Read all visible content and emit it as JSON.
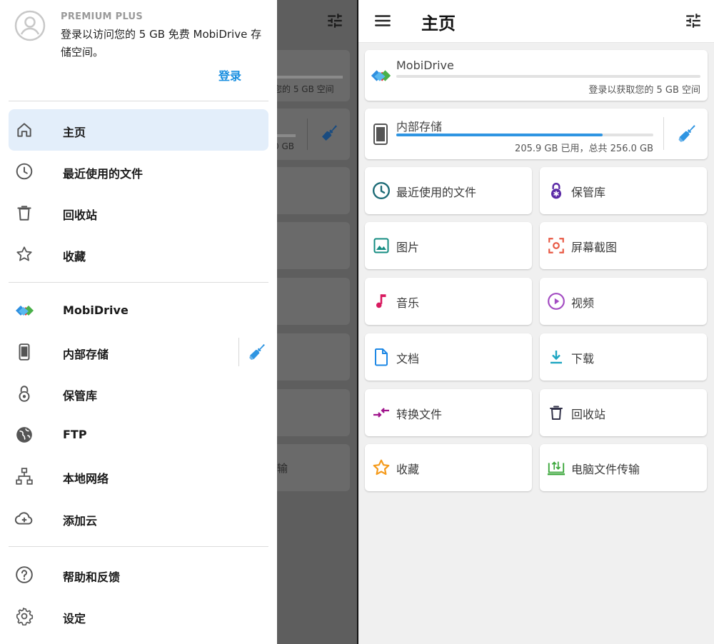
{
  "drawer": {
    "tier": "PREMIUM PLUS",
    "prompt": "登录以访问您的 5 GB 免费 MobiDrive 存储空间。",
    "login": "登录",
    "items": [
      {
        "label": "主页",
        "icon": "home-icon",
        "active": true
      },
      {
        "label": "最近使用的文件",
        "icon": "clock-icon"
      },
      {
        "label": "回收站",
        "icon": "trash-icon"
      },
      {
        "label": "收藏",
        "icon": "star-icon"
      },
      {
        "label": "MobiDrive",
        "icon": "mobidrive-logo-icon"
      },
      {
        "label": "内部存储",
        "icon": "phone-icon"
      },
      {
        "label": "保管库",
        "icon": "lock-icon"
      },
      {
        "label": "FTP",
        "icon": "globe-icon"
      },
      {
        "label": "本地网络",
        "icon": "network-icon"
      },
      {
        "label": "添加云",
        "icon": "cloud-add-icon"
      },
      {
        "label": "帮助和反馈",
        "icon": "help-icon"
      },
      {
        "label": "设定",
        "icon": "gear-icon"
      }
    ]
  },
  "background": {
    "mobidrive_hint": "您的 5 GB 空间",
    "storage_hint": "0 GB",
    "transfer_hint": "输"
  },
  "home": {
    "title": "主页",
    "mobidrive": {
      "name": "MobiDrive",
      "subtitle": "登录以获取您的 5 GB 空间"
    },
    "storage": {
      "name": "内部存储",
      "usage": "205.9 GB 已用，总共 256.0 GB",
      "used_fraction": 0.804
    },
    "tiles": [
      {
        "label": "最近使用的文件",
        "icon": "clock-icon",
        "color": "#1e6c77"
      },
      {
        "label": "保管库",
        "icon": "lock-icon",
        "color": "#5b2aa6"
      },
      {
        "label": "图片",
        "icon": "image-icon",
        "color": "#148c82"
      },
      {
        "label": "屏幕截图",
        "icon": "screenshot-icon",
        "color": "#e85a45"
      },
      {
        "label": "音乐",
        "icon": "music-icon",
        "color": "#d81b60"
      },
      {
        "label": "视频",
        "icon": "video-icon",
        "color": "#a34cc2"
      },
      {
        "label": "文档",
        "icon": "document-icon",
        "color": "#1e88e5"
      },
      {
        "label": "下载",
        "icon": "download-icon",
        "color": "#1ea6c2"
      },
      {
        "label": "转换文件",
        "icon": "convert-icon",
        "color": "#a0148c"
      },
      {
        "label": "回收站",
        "icon": "trash-icon",
        "color": "#33334a"
      },
      {
        "label": "收藏",
        "icon": "star-icon",
        "color": "#f59a1a"
      },
      {
        "label": "电脑文件传输",
        "icon": "pc-transfer-icon",
        "color": "#3aa63a"
      }
    ]
  },
  "colors": {
    "accent": "#1a8fe0",
    "progress": "#2f95e2",
    "active_bg": "#e3eefa"
  }
}
